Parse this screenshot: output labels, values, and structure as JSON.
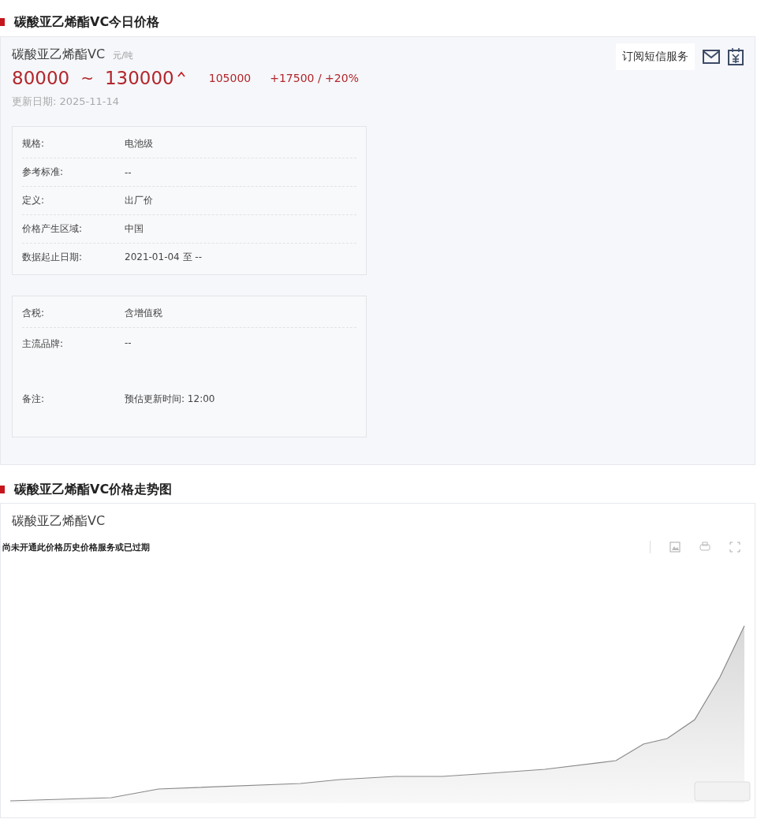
{
  "price_section": {
    "title": "碳酸亚乙烯酯VC今日价格",
    "product_name": "碳酸亚乙烯酯VC",
    "unit": "元/吨",
    "price_low": "80000",
    "separator": "~",
    "price_high": "130000",
    "average": "105000",
    "change": "+17500 / +20%",
    "update_date": "更新日期: 2025-11-14",
    "subscribe_button": "订阅短信服务",
    "spec_groups": [
      [
        {
          "label": "规格:",
          "value": "电池级",
          "kind": "line"
        },
        {
          "label": "参考标准:",
          "value": "--",
          "kind": "line"
        },
        {
          "label": "定义:",
          "value": "出厂价",
          "kind": "line"
        },
        {
          "label": "价格产生区域:",
          "value": "中国",
          "kind": "line"
        },
        {
          "label": "数据起止日期:",
          "value": "2021-01-04 至 --",
          "kind": "line"
        }
      ],
      [
        {
          "label": "含税:",
          "value": "含增值税",
          "kind": "line"
        },
        {
          "label": "主流品牌:",
          "value": "--",
          "kind": "tall"
        },
        {
          "label": "备注:",
          "value": "预估更新时间: 12:00",
          "kind": "tall"
        }
      ]
    ]
  },
  "trend_section": {
    "title": "碳酸亚乙烯酯VC价格走势图",
    "chart_title": "碳酸亚乙烯酯VC",
    "notice": "尚未开通此价格历史价格服务或已过期"
  }
}
